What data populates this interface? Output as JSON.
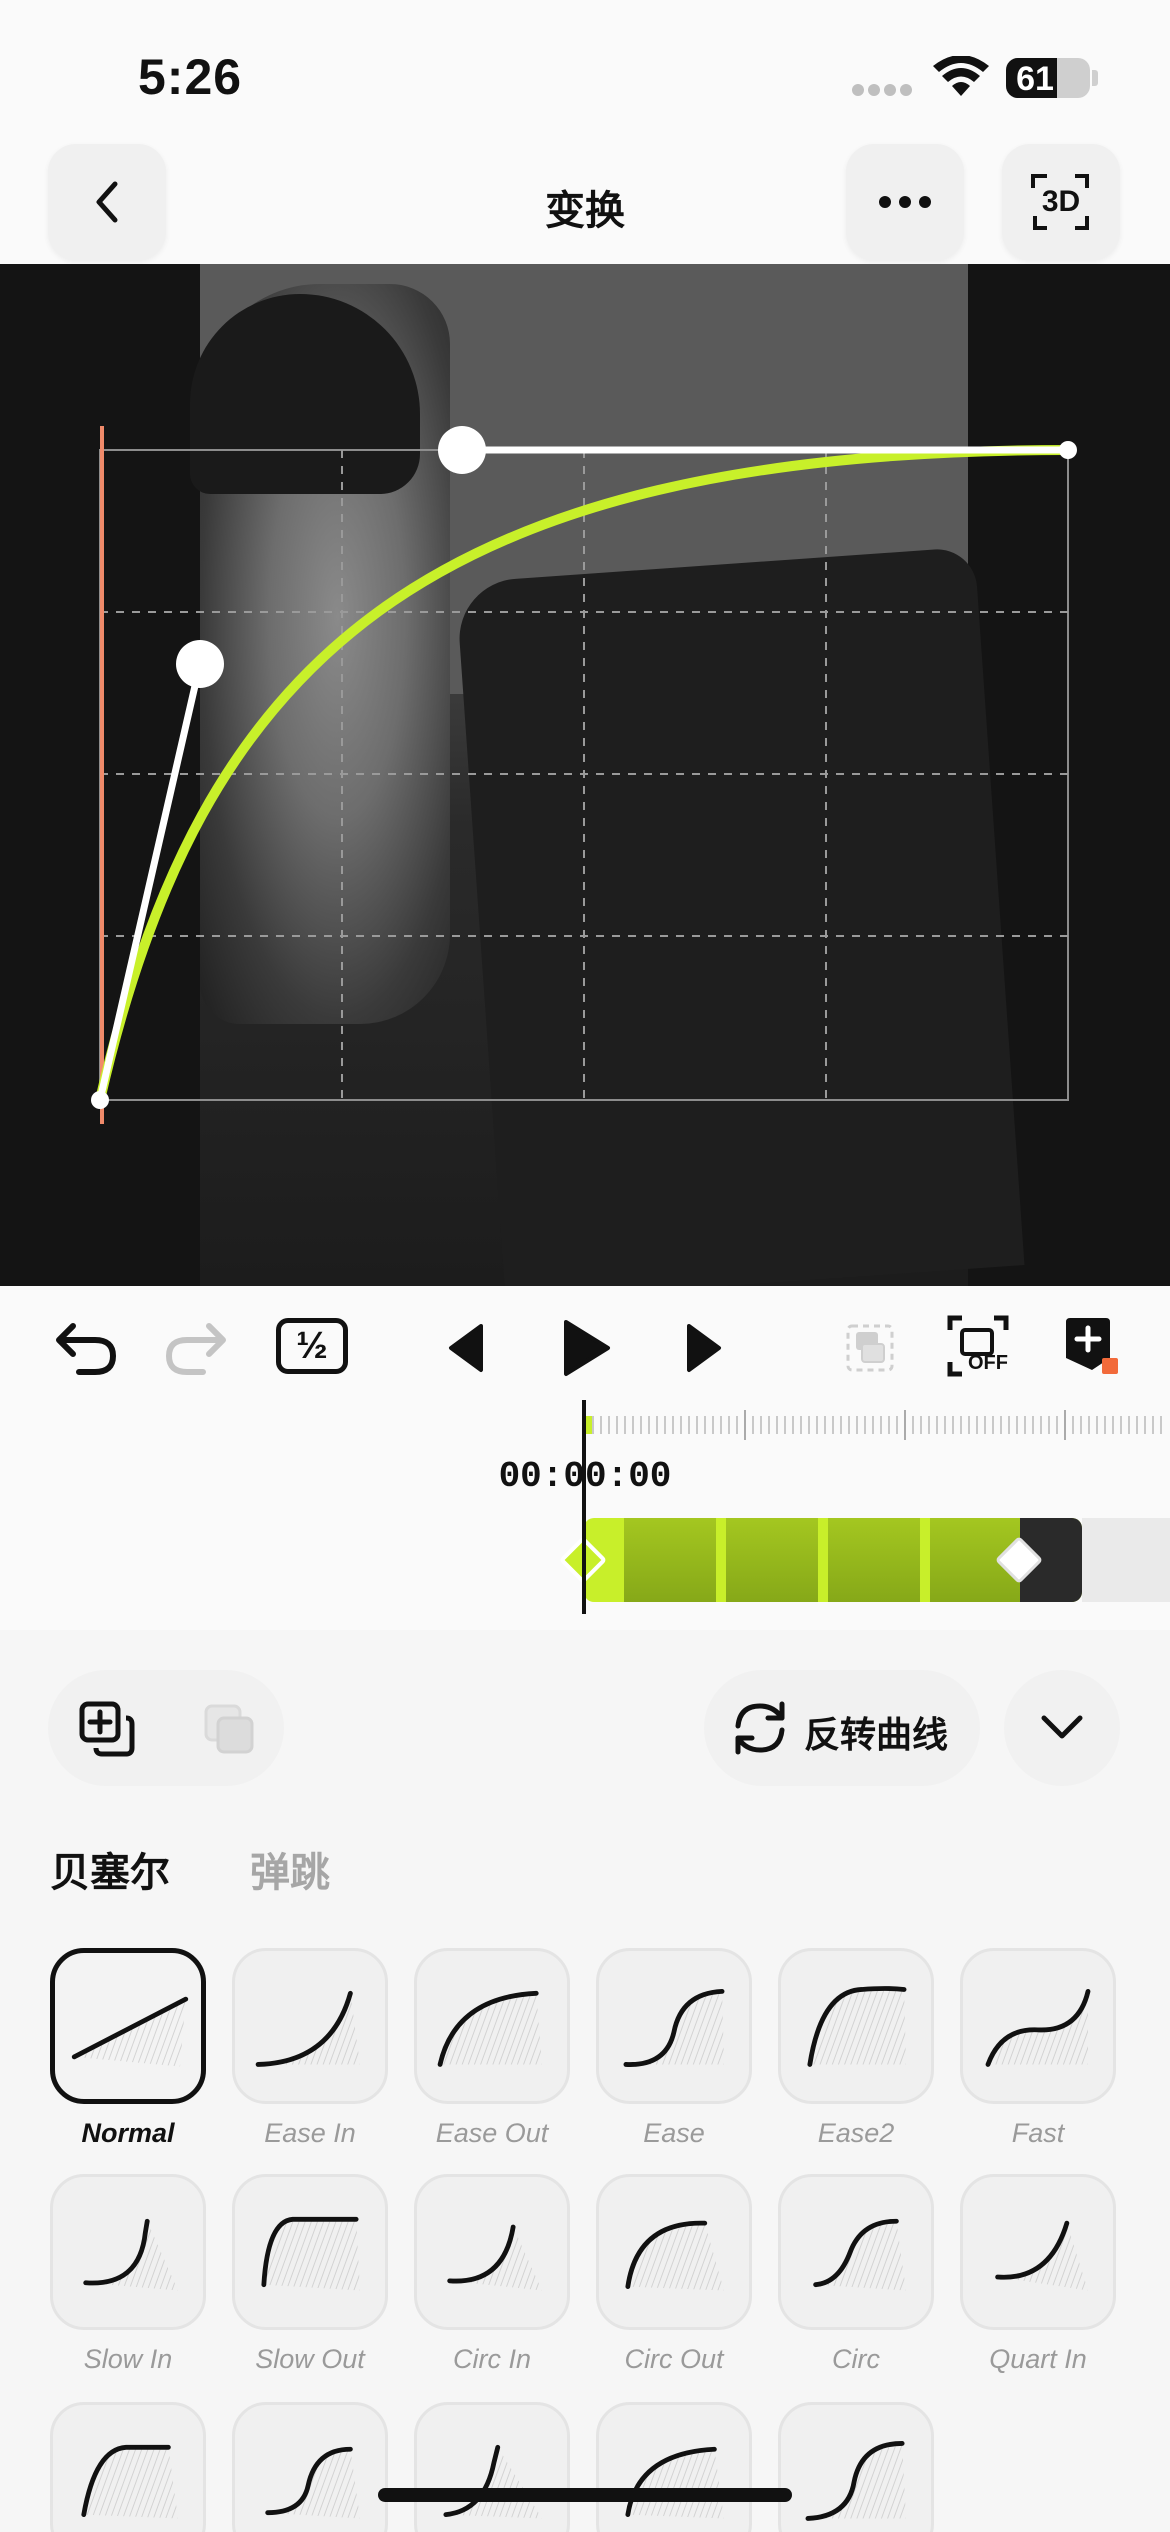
{
  "status_bar": {
    "time": "5:26",
    "battery": "61",
    "battery_level": 0.61
  },
  "nav": {
    "back_icon": "chevron-left-icon",
    "title": "变换",
    "more_icon": "ellipsis-icon",
    "view3d_label": "3D"
  },
  "preview": {
    "curve_color": "#c8f02a",
    "handle_color": "#ffffff",
    "start_marker_color": "#f08a6a"
  },
  "controls": {
    "undo_icon": "undo-icon",
    "redo_icon": "redo-icon",
    "speed_label": "½",
    "prev_frame_icon": "prev-frame-icon",
    "play_icon": "play-icon",
    "next_frame_icon": "next-frame-icon",
    "layer_icon": "layer-icon",
    "fit_label": "OFF",
    "add_keyframe_icon": "add-keyframe-icon"
  },
  "timeline": {
    "timecode": "00:00:00",
    "clip_color": "#c8ef2a"
  },
  "panel": {
    "copy_icon": "copy-curve-icon",
    "paste_icon": "paste-curve-icon",
    "reverse_label": "反转曲线",
    "reverse_icon": "reverse-icon",
    "collapse_icon": "chevron-down-icon",
    "tabs": [
      {
        "label": "贝塞尔",
        "active": true
      },
      {
        "label": "弹跳",
        "active": false
      }
    ],
    "presets": [
      {
        "label": "Normal",
        "selected": true
      },
      {
        "label": "Ease In"
      },
      {
        "label": "Ease Out"
      },
      {
        "label": "Ease"
      },
      {
        "label": "Ease2"
      },
      {
        "label": "Fast"
      },
      {
        "label": "Slow In"
      },
      {
        "label": "Slow Out"
      },
      {
        "label": "Circ In"
      },
      {
        "label": "Circ Out"
      },
      {
        "label": "Circ"
      },
      {
        "label": "Quart In"
      },
      {
        "label": ""
      },
      {
        "label": ""
      },
      {
        "label": ""
      },
      {
        "label": ""
      },
      {
        "label": ""
      }
    ]
  }
}
